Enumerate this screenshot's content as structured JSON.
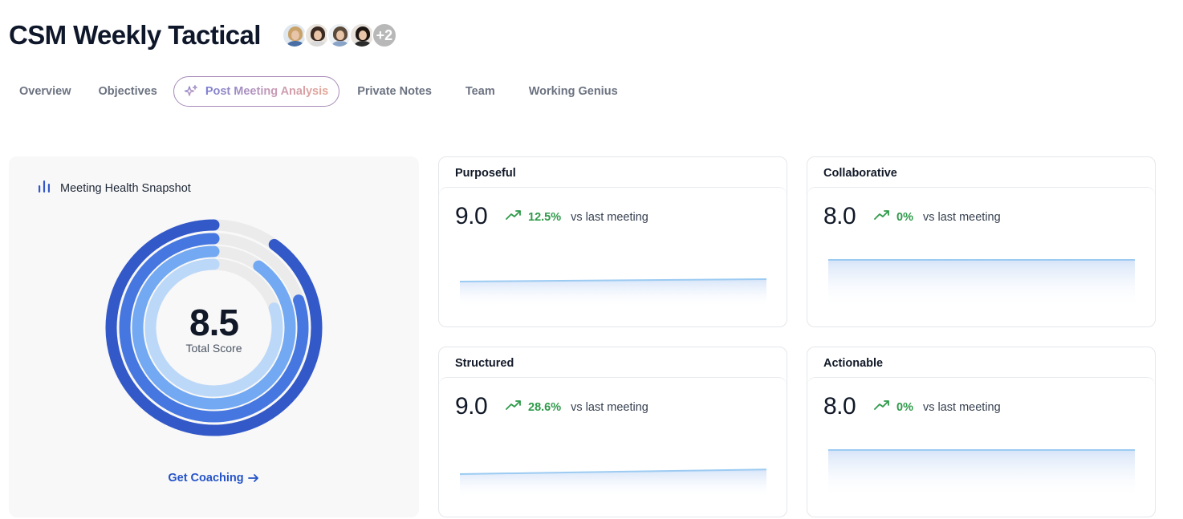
{
  "header": {
    "title": "CSM Weekly Tactical",
    "avatars": [
      {
        "hair": "#c9a26a",
        "body": "#4a6fa5"
      },
      {
        "hair": "#3a2a22",
        "body": "#d9d9d9"
      },
      {
        "hair": "#5a4a3a",
        "body": "#8aa4c8"
      },
      {
        "hair": "#1e1612",
        "body": "#2c2c2c"
      }
    ],
    "more_count": "+2"
  },
  "tabs": [
    {
      "label": "Overview"
    },
    {
      "label": "Objectives"
    },
    {
      "label": "Post Meeting Analysis",
      "active": true
    },
    {
      "label": "Private Notes"
    },
    {
      "label": "Team"
    },
    {
      "label": "Working Genius"
    }
  ],
  "snapshot": {
    "title": "Meeting Health Snapshot",
    "total_score": "8.5",
    "total_label": "Total Score",
    "coaching_label": "Get Coaching",
    "rings": [
      {
        "value": 9.0,
        "max": 10,
        "color": "#3358c8"
      },
      {
        "value": 8.0,
        "max": 10,
        "color": "#4677e0"
      },
      {
        "value": 9.0,
        "max": 10,
        "color": "#72a9f2"
      },
      {
        "value": 8.0,
        "max": 10,
        "color": "#bcd8f8"
      }
    ],
    "track_color": "#ebebeb"
  },
  "metrics": [
    {
      "title": "Purposeful",
      "value": "9.0",
      "change": "12.5%",
      "vs": "vs last meeting",
      "trend": [
        8.0,
        9.0
      ]
    },
    {
      "title": "Collaborative",
      "value": "8.0",
      "change": "0%",
      "vs": "vs last meeting",
      "trend": [
        8.0,
        8.0
      ]
    },
    {
      "title": "Structured",
      "value": "9.0",
      "change": "28.6%",
      "vs": "vs last meeting",
      "trend": [
        7.0,
        9.0
      ]
    },
    {
      "title": "Actionable",
      "value": "8.0",
      "change": "0%",
      "vs": "vs last meeting",
      "trend": [
        8.0,
        8.0
      ]
    }
  ],
  "colors": {
    "accent_blue": "#2453c8",
    "positive_green": "#2f9a4a",
    "sparkline": "#9ccbf2"
  },
  "icons": {
    "snapshot": "bar-chart-icon",
    "tab_active": "sparkle-icon",
    "coaching": "arrow-right-icon",
    "trend": "trending-up-icon"
  }
}
